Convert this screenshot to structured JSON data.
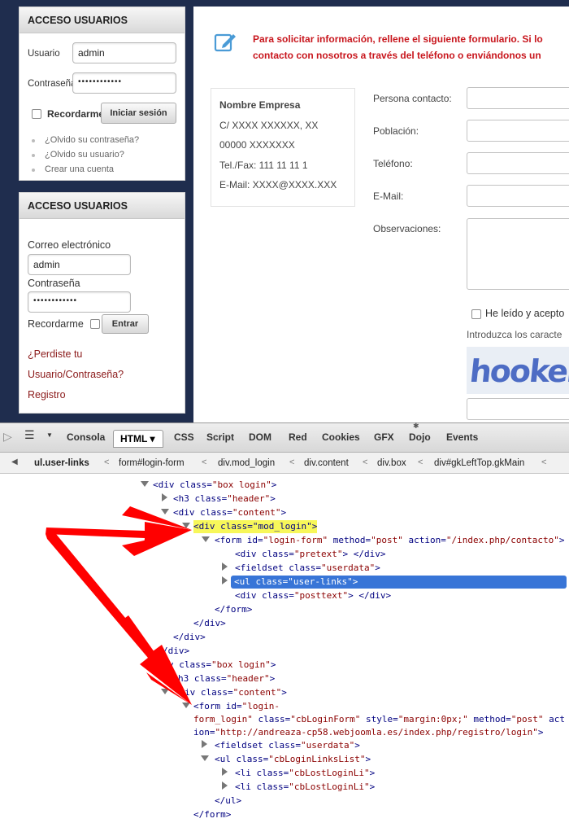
{
  "login_box_1": {
    "header": "ACCESO USUARIOS",
    "user_label": "Usuario",
    "user_value": "admin",
    "password_label": "Contraseña",
    "password_value": "••••••••••••",
    "remember_label": "Recordarme",
    "submit_label": "Iniciar sesión",
    "links": [
      "¿Olvido su contraseña?",
      "¿Olvido su usuario?",
      "Crear una cuenta"
    ]
  },
  "login_box_2": {
    "header": "ACCESO USUARIOS",
    "email_label": "Correo electrónico",
    "email_value": "admin",
    "password_label": "Contraseña",
    "password_value": "••••••••••••",
    "remember_label": "Recordarme",
    "submit_label": "Entrar",
    "lost_line1": "¿Perdiste tu",
    "lost_line2": "Usuario/Contraseña?",
    "register": "Registro"
  },
  "contact": {
    "intro_line1": "Para solicitar información, rellene el siguiente formulario. Si lo",
    "intro_line2": "contacto con nosotros  a través del teléfono o enviándonos un",
    "company": [
      "Nombre Empresa",
      "C/ XXXX XXXXXX, XX",
      "00000 XXXXXXX",
      "Tel./Fax: 111 11 11 1",
      "E-Mail: XXXX@XXXX.XXX"
    ],
    "fields": [
      "Persona contacto:",
      "Población:",
      "Teléfono:",
      "E-Mail:",
      "Observaciones:"
    ],
    "accept_label": "He leído y acepto",
    "captcha_label": "Introduzca los caracte",
    "captcha_text": "hooker"
  },
  "firebug": {
    "tabs": [
      "Consola",
      "HTML ▾",
      "CSS",
      "Script",
      "DOM",
      "Red",
      "Cookies",
      "GFX",
      "Dojo",
      "Events"
    ],
    "breadcrumbs": [
      "ul.user-links",
      "form#login-form",
      "div.mod_login",
      "div.content",
      "div.box",
      "div#gkLeftTop.gkMain"
    ]
  },
  "tree": {
    "l1_tag": "<div",
    "l1_attr": "class=",
    "l1_val": "\"box login\"",
    "l1_end": ">",
    "l2": "<h3",
    "l2_attr": "class=",
    "l2_val": "\"header\"",
    "l2_end": ">",
    "l3": "<div",
    "l3_attr": "class=",
    "l3_val": "\"content\"",
    "l3_end": ">",
    "l4": "<div class=\"mod_login\">",
    "l5_a": "<form",
    "l5_b": "id=",
    "l5_c": "\"login-form\"",
    "l5_d": "method=",
    "l5_e": "\"post\"",
    "l5_f": "action=",
    "l5_g": "\"/index.php/contacto\"",
    "l5_h": ">",
    "l6_a": "<div",
    "l6_b": "class=",
    "l6_c": "\"pretext\"",
    "l6_d": ">  </div>",
    "l7_a": "<fieldset",
    "l7_b": "class=",
    "l7_c": "\"userdata\"",
    "l7_d": ">",
    "l8": "<ul class=\"user-links\">",
    "l9_a": "<div",
    "l9_b": "class=",
    "l9_c": "\"posttext\"",
    "l9_d": ">  </div>",
    "l10": "</form>",
    "l11": "</div>",
    "l12": "</div>",
    "l13": "/div>",
    "l14_a": "v",
    "l14_b": "class=",
    "l14_c": "\"box login\"",
    "l14_d": ">",
    "l15_a": "h3",
    "l15_b": "class=",
    "l15_c": "\"header\"",
    "l15_d": ">",
    "l16_a": "iv",
    "l16_b": "class=",
    "l16_c": "\"content\"",
    "l16_d": ">",
    "l17_a": "<form",
    "l17_b": "id=",
    "l17_c": "\"login-",
    "l18_a": "form_login\"",
    "l18_b": "class=",
    "l18_c": "\"cbLoginForm\"",
    "l18_d": "style=",
    "l18_e": "\"margin:0px;\"",
    "l18_f": "method=",
    "l18_g": "\"post\"",
    "l18_h": "act",
    "l19_a": "ion=",
    "l19_b": "\"http://andreaza-cp58.webjoomla.es/index.php/registro/login\"",
    "l19_c": ">",
    "l20_a": "<fieldset",
    "l20_b": "class=",
    "l20_c": "\"userdata\"",
    "l20_d": ">",
    "l21_a": "<ul",
    "l21_b": "class=",
    "l21_c": "\"cbLoginLinksList\"",
    "l21_d": ">",
    "l22_a": "<li",
    "l22_b": "class=",
    "l22_c": "\"cbLostLoginLi\"",
    "l22_d": ">",
    "l23_a": "<li",
    "l23_b": "class=",
    "l23_c": "\"cbLostLoginLi\"",
    "l23_d": ">",
    "l24": "</ul>",
    "l25": "</form>"
  },
  "colors": {
    "sidebar_bg": "#1f2d4e",
    "intro_red": "#c8161d",
    "link_red": "#8b1a1a",
    "selection": "#3875d7",
    "highlight": "#f7f75a",
    "arrow": "#ff0000"
  }
}
